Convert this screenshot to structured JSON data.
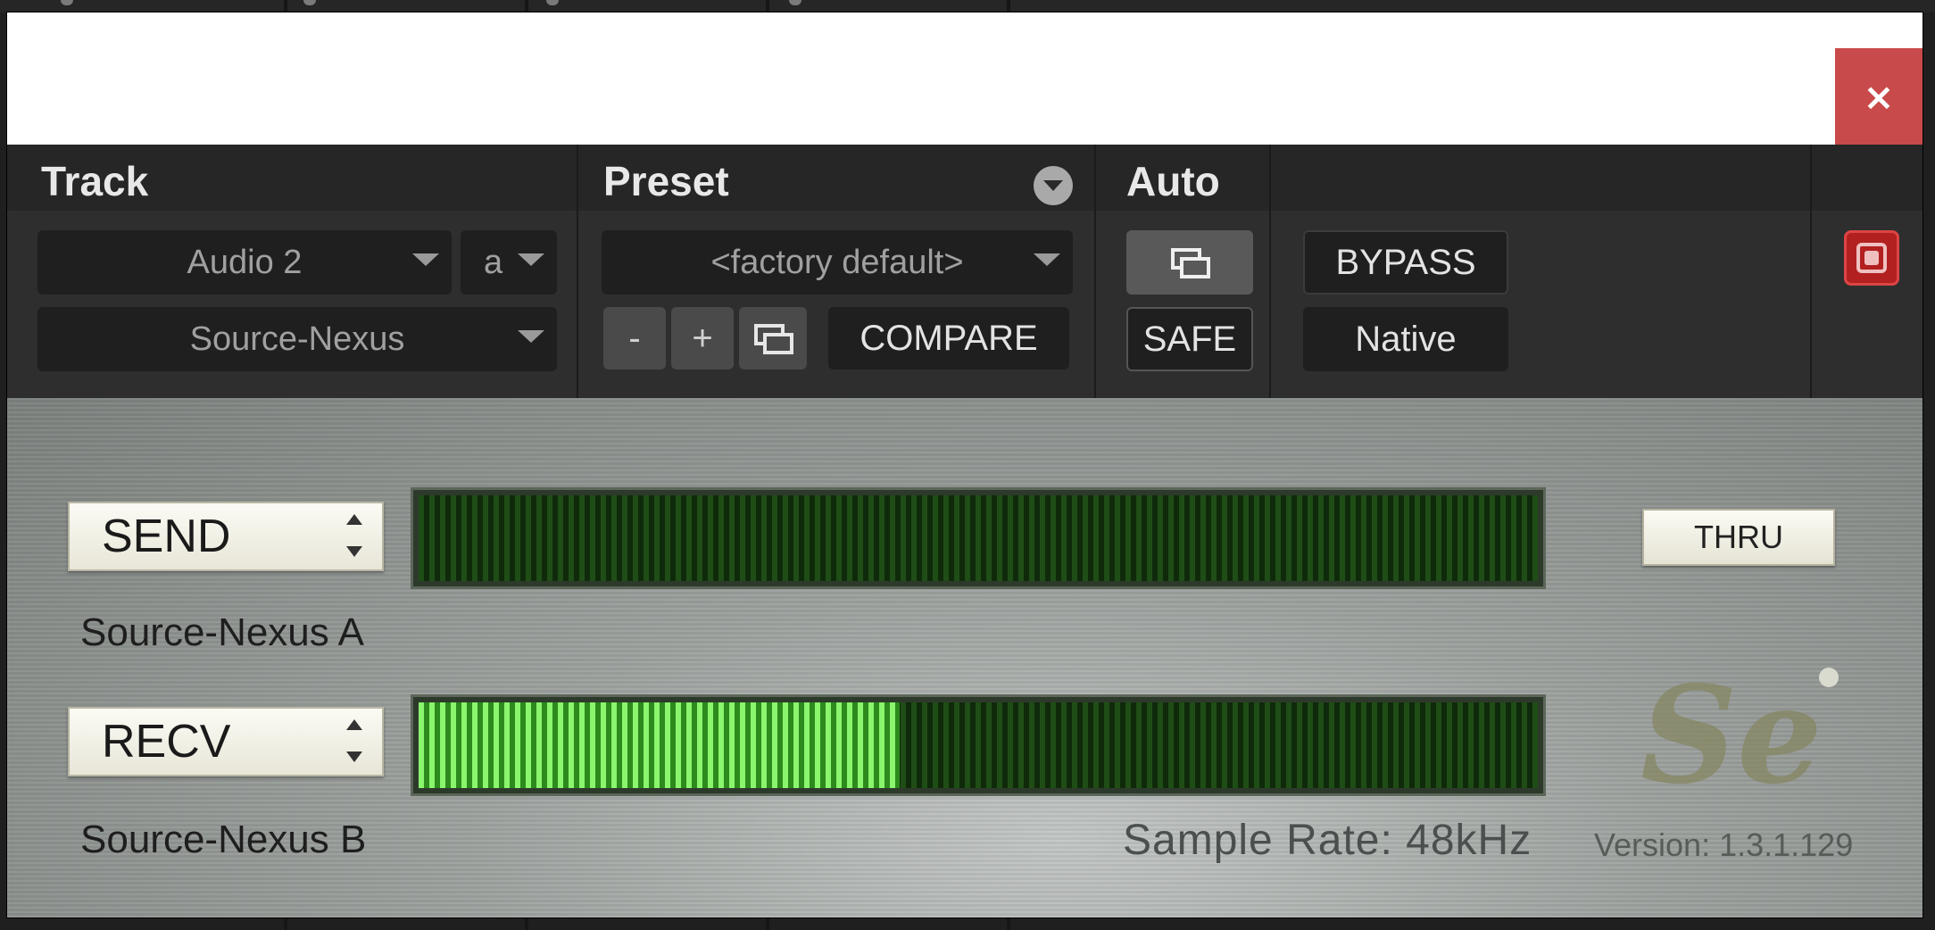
{
  "header": {
    "track_label": "Track",
    "preset_label": "Preset",
    "auto_label": "Auto",
    "track_name": "Audio 2",
    "track_variant": "a",
    "plugin_name": "Source-Nexus",
    "preset_name": "<factory default>",
    "minus_label": "-",
    "plus_label": "+",
    "compare_label": "COMPARE",
    "safe_label": "SAFE",
    "bypass_label": "BYPASS",
    "native_label": "Native"
  },
  "close_label": "×",
  "plugin": {
    "send": {
      "mode": "SEND",
      "name": "Source-Nexus A",
      "level": 0
    },
    "recv": {
      "mode": "RECV",
      "name": "Source-Nexus B",
      "level": 0.43
    },
    "thru_label": "THRU",
    "logo_text": "Se",
    "sample_rate": "Sample Rate: 48kHz",
    "version": "Version: 1.3.1.129"
  },
  "icons": {
    "preset_menu": "chevron-down-circle-icon",
    "window_link": "window-stack-icon",
    "power": "power-icon",
    "close": "close-icon"
  },
  "colors": {
    "close_bg": "#c94a4a",
    "meter_on": "#8af56d",
    "meter_off": "#1f4d16",
    "power": "#b32020"
  }
}
